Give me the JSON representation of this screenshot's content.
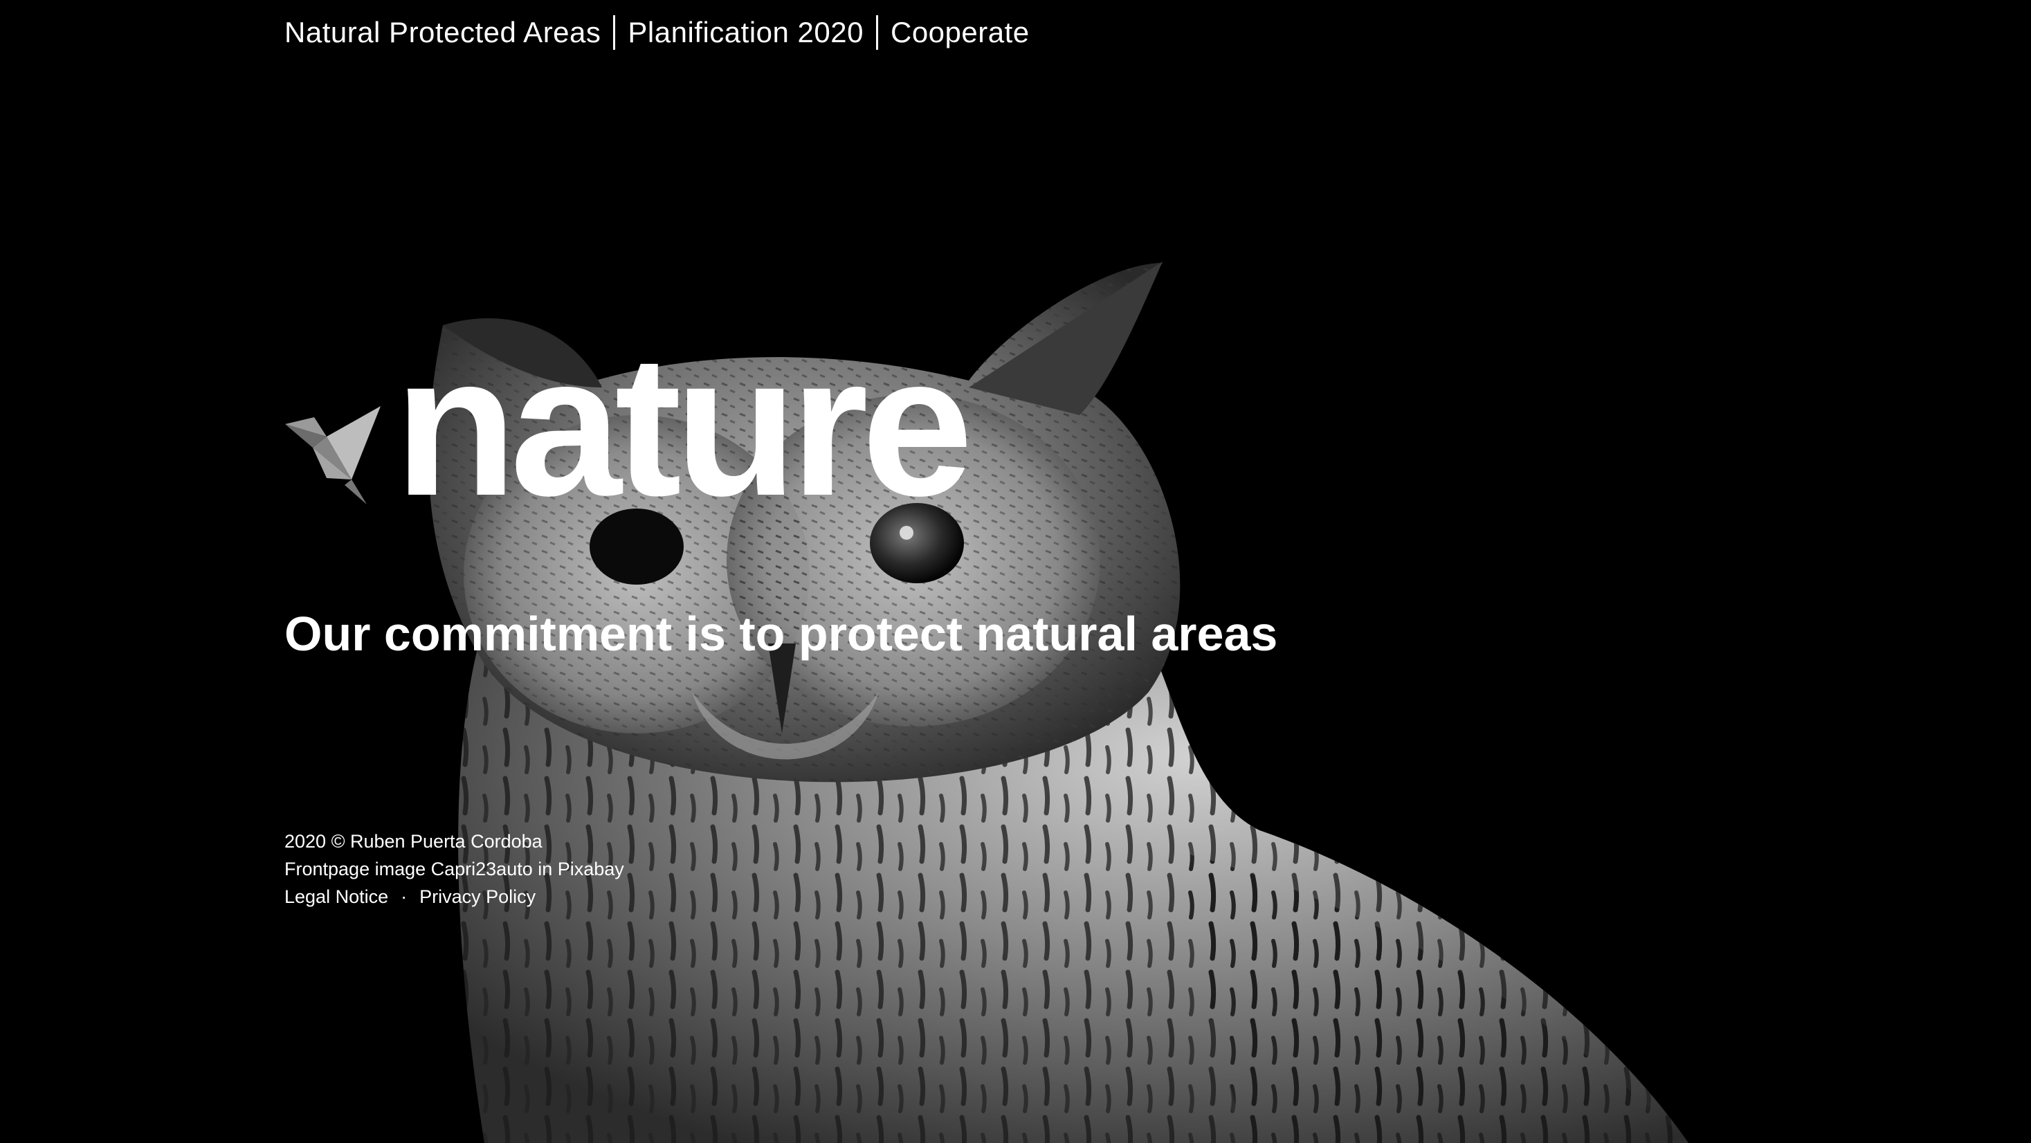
{
  "nav": {
    "items": [
      {
        "label": "Natural Protected Areas"
      },
      {
        "label": "Planification 2020"
      },
      {
        "label": "Cooperate"
      }
    ]
  },
  "hero": {
    "title": "nature",
    "tagline": "Our commitment is to protect natural areas",
    "logo_icon": "origami-bird-icon",
    "background_image": "owl-photo"
  },
  "footer": {
    "copyright": "2020 © Ruben Puerta Cordoba",
    "image_credit": "Frontpage image Capri23auto in Pixabay",
    "legal_notice": "Legal Notice",
    "separator": "·",
    "privacy_policy": "Privacy Policy"
  },
  "colors": {
    "background": "#000000",
    "text": "#ffffff"
  }
}
